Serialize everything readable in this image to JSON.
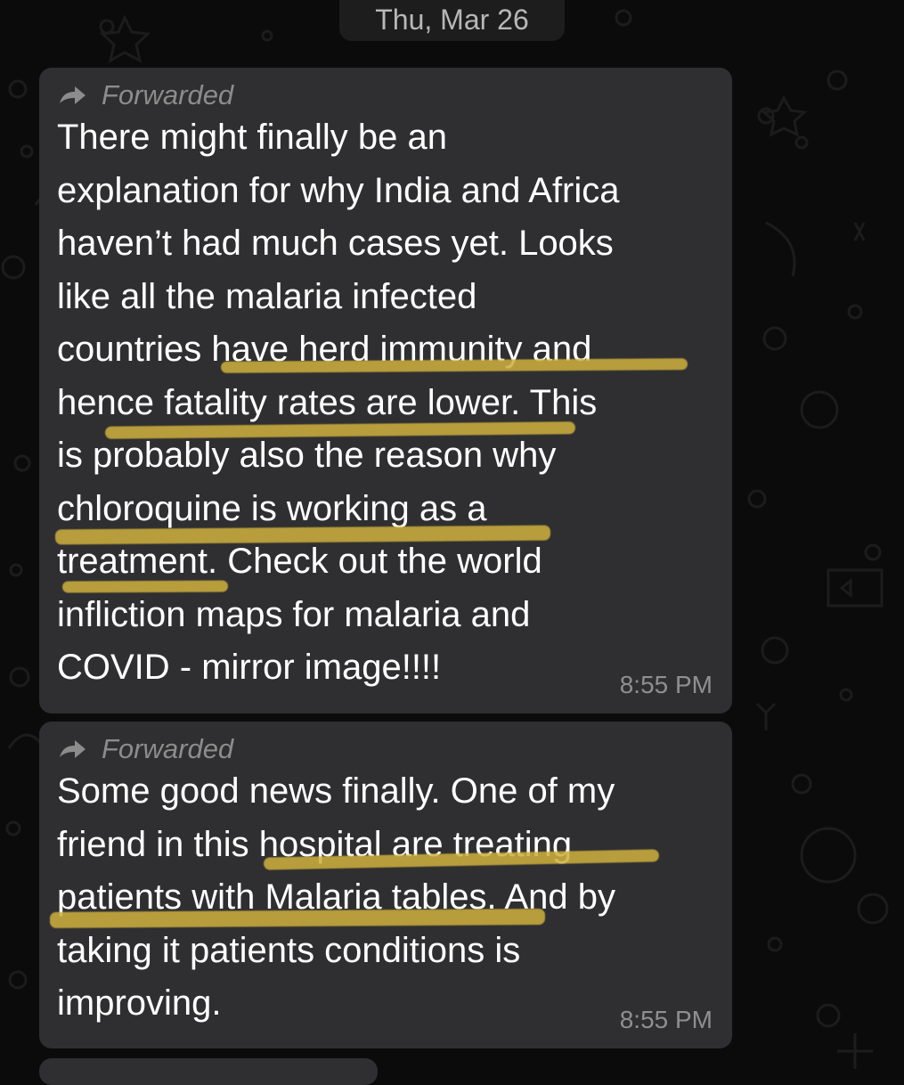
{
  "date_separator": "Thu, Mar 26",
  "messages": [
    {
      "forwarded_label": "Forwarded",
      "text": "There might finally be an\nexplanation for why India and Africa\nhaven’t had much cases yet.  Looks\nlike all the malaria infected\ncountries have herd immunity and\nhence fatality rates are lower.  This\nis probably also the reason why\nchloroquine is working as a\ntreatment.  Check out the world\ninfliction maps for malaria and\nCOVID - mirror image!!!!",
      "time": "8:55 PM"
    },
    {
      "forwarded_label": "Forwarded",
      "text": "Some good news finally. One of my\nfriend in this hospital are treating\npatients with Malaria tables. And by\ntaking it patients conditions is\nimproving.",
      "time": "8:55 PM"
    }
  ],
  "colors": {
    "background": "#0b0b0b",
    "bubble": "#2f2f31",
    "highlight": "#cdaf3c",
    "text": "#ffffff",
    "meta": "#8c8c8c"
  },
  "icons": {
    "forwarded": "forward-arrow-icon"
  }
}
